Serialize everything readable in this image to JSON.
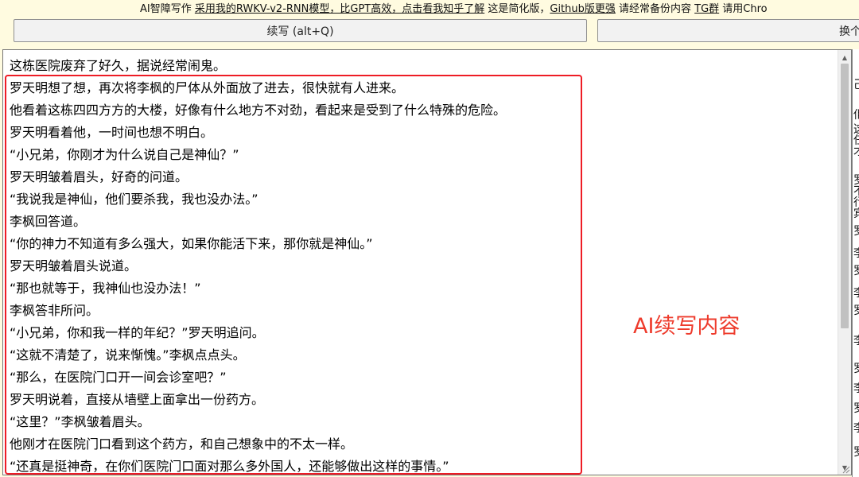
{
  "topbar": {
    "prefix": "AI智障写作 ",
    "link_model": "采用我的RWKV-v2-RNN模型，比GPT高效，点击看我知乎了解",
    "mid1": " 这是简化版，",
    "link_github": "Github版更强",
    "mid2": " 请经常备份内容 ",
    "link_tg": "TG群",
    "suffix": " 请用Chro"
  },
  "buttons": {
    "continue_label": "续写 (alt+Q)",
    "swap_label": "换个"
  },
  "editor": {
    "lines": [
      "这栋医院废弃了好久，据说经常闹鬼。",
      "罗天明想了想，再次将李枫的尸体从外面放了进去，很快就有人进来。",
      "他看着这栋四四方方的大楼，好像有什么地方不对劲，看起来是受到了什么特殊的危险。",
      "罗天明看着他，一时间也想不明白。",
      "“小兄弟，你刚才为什么说自己是神仙？”",
      "罗天明皱着眉头，好奇的问道。",
      "“我说我是神仙，他们要杀我，我也没办法。”",
      "李枫回答道。",
      "“你的神力不知道有多么强大，如果你能活下来，那你就是神仙。”",
      "罗天明皱着眉头说道。",
      "“那也就等于，我神仙也没办法！”",
      "李枫答非所问。",
      "“小兄弟，你和我一样的年纪？”罗天明追问。",
      "“这就不清楚了，说来惭愧。”李枫点点头。",
      "“那么，在医院门口开一间会诊室吧？”",
      "罗天明说着，直接从墙壁上面拿出一份药方。",
      "“这里？”李枫皱着眉头。",
      "他刚才在医院门口看到这个药方，和自己想象中的不太一样。",
      "“还真是挺神奇，在你们医院门口面对那么多外国人，还能够做出这样的事情。”"
    ]
  },
  "annotation": {
    "label": "AI续写内容",
    "color": "#ee3b2c",
    "box_color": "#ee1c25"
  },
  "icons": {
    "scroll_up": "scroll-up-arrow-icon",
    "scroll_down": "scroll-down-arrow-icon",
    "resize": "resize-grip-icon"
  },
  "right_panel": {
    "glyphs": [
      "己",
      "佢",
      "这",
      "任",
      "才",
      "罗",
      "不",
      "行",
      "宾",
      "罗",
      "李",
      "罗",
      "李",
      "罗",
      "李",
      "罗",
      "李",
      "罗",
      "李",
      "罗"
    ]
  }
}
